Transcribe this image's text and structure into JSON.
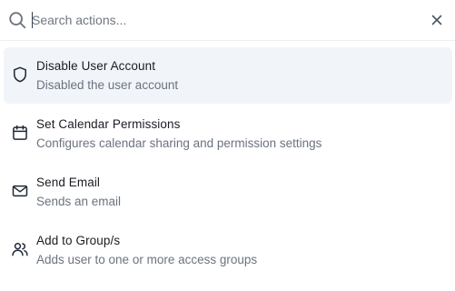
{
  "search": {
    "placeholder": "Search actions...",
    "value": ""
  },
  "actions": [
    {
      "title": "Disable User Account",
      "description": "Disabled the user account",
      "icon": "shield-icon"
    },
    {
      "title": "Set Calendar Permissions",
      "description": "Configures calendar sharing and permission settings",
      "icon": "calendar-icon"
    },
    {
      "title": "Send Email",
      "description": "Sends an email",
      "icon": "mail-icon"
    },
    {
      "title": "Add to Group/s",
      "description": "Adds user to one or more access groups",
      "icon": "users-icon"
    }
  ],
  "colors": {
    "highlight": "#f1f5f9",
    "text": "#1a1d23",
    "muted": "#6b7280"
  }
}
